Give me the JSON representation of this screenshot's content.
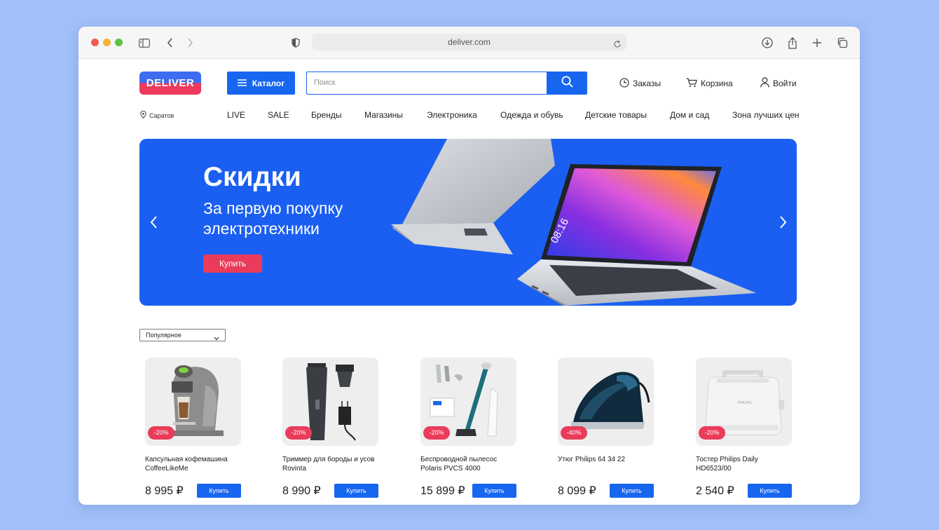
{
  "browser": {
    "url": "deliver.com"
  },
  "header": {
    "logo": "DELIVER",
    "catalog_label": "Каталог",
    "search_placeholder": "Поиск",
    "orders": "Заказы",
    "cart": "Корзина",
    "login": "Войти"
  },
  "location": "Саратов",
  "nav": [
    "LIVE",
    "SALE",
    "Бренды",
    "Магазины",
    "Электроника",
    "Одежда и обувь",
    "Детские товары",
    "Дом и сад",
    "Зона лучших цен"
  ],
  "banner": {
    "title": "Скидки",
    "subtitle": "За первую покупку электротехники",
    "button": "Купить",
    "background": "#1a5ff1"
  },
  "sort": {
    "selected": "Популярное"
  },
  "products": [
    {
      "name": "Капсульная кофемашина CoffeeLikeMe",
      "price": "8 995 ₽",
      "discount": "-20%",
      "button": "Купить",
      "icon": "coffee-machine"
    },
    {
      "name": "Триммер для бороды и усов Rovinta",
      "price": "8 990 ₽",
      "discount": "-20%",
      "button": "Купить",
      "icon": "trimmer"
    },
    {
      "name": "Беспроводной пылесос Polaris PVCS 4000",
      "price": "15 899 ₽",
      "discount": "-20%",
      "button": "Купить",
      "icon": "vacuum-cleaner"
    },
    {
      "name": "Утюг Philips 64 34 22",
      "price": "8 099 ₽",
      "discount": "-40%",
      "button": "Купить",
      "icon": "iron"
    },
    {
      "name": "Тостер Philips Daily HD6523/00",
      "price": "2 540 ₽",
      "discount": "-20%",
      "button": "Купить",
      "icon": "toaster"
    }
  ],
  "colors": {
    "accent": "#1766f0",
    "sale": "#ea3b5a",
    "page_bg": "#a1bff8"
  }
}
